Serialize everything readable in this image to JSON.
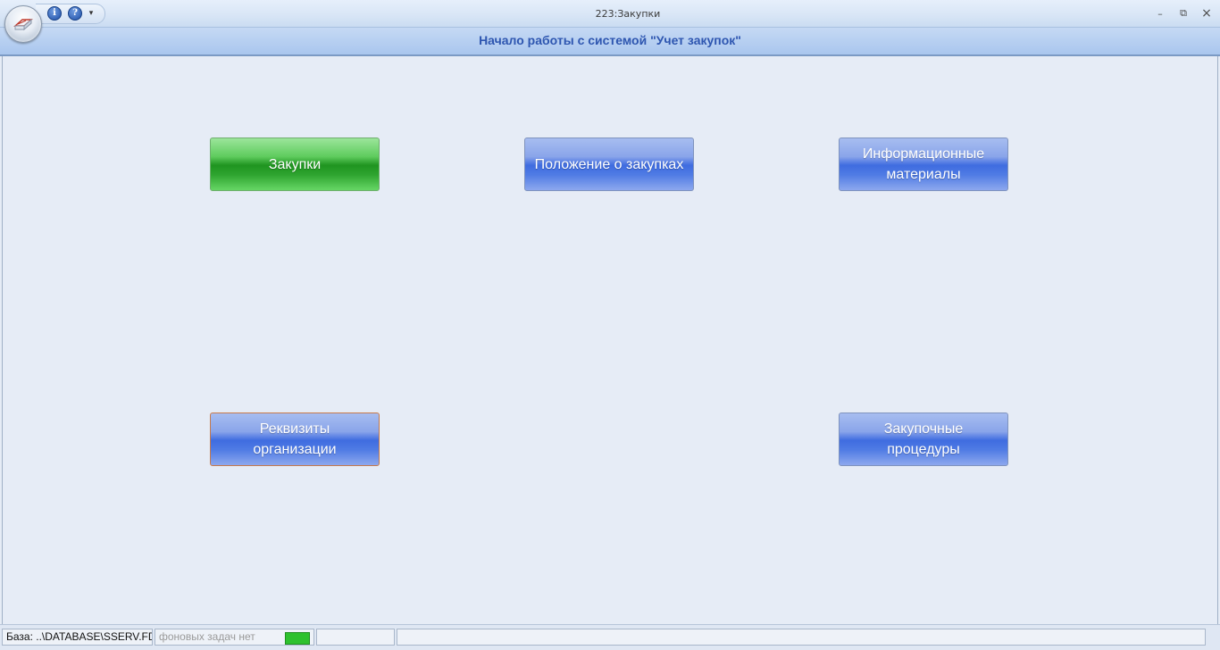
{
  "window": {
    "title": "223:Закупки",
    "controls": {
      "minimize": "–",
      "restore": "⧉",
      "close": "×"
    }
  },
  "quick_access": {
    "info_icon": "info-icon",
    "help_icon": "help-icon",
    "customize_icon": "dropdown-arrow-icon",
    "info_glyph": "i",
    "help_glyph": "?",
    "customize_glyph": "▾"
  },
  "header": {
    "title": "Начало работы с системой \"Учет закупок\""
  },
  "tiles": [
    {
      "label": "Закупки",
      "color": "green"
    },
    {
      "label": "Положение о закупках",
      "color": "blue"
    },
    {
      "label": "Информационные материалы",
      "color": "blue"
    },
    {
      "label": "Реквизиты организации",
      "color": "blue",
      "focused": true
    },
    {
      "label": "Закупочные процедуры",
      "color": "blue"
    }
  ],
  "status": {
    "database": "База: ..\\DATABASE\\SSERV.FDB",
    "tasks": "фоновых задач нет",
    "indicator_color": "#2ec12e"
  },
  "colors": {
    "accent_header_text": "#2e56b0",
    "tile_blue": "#4f7be4",
    "tile_green": "#2ea42f"
  }
}
